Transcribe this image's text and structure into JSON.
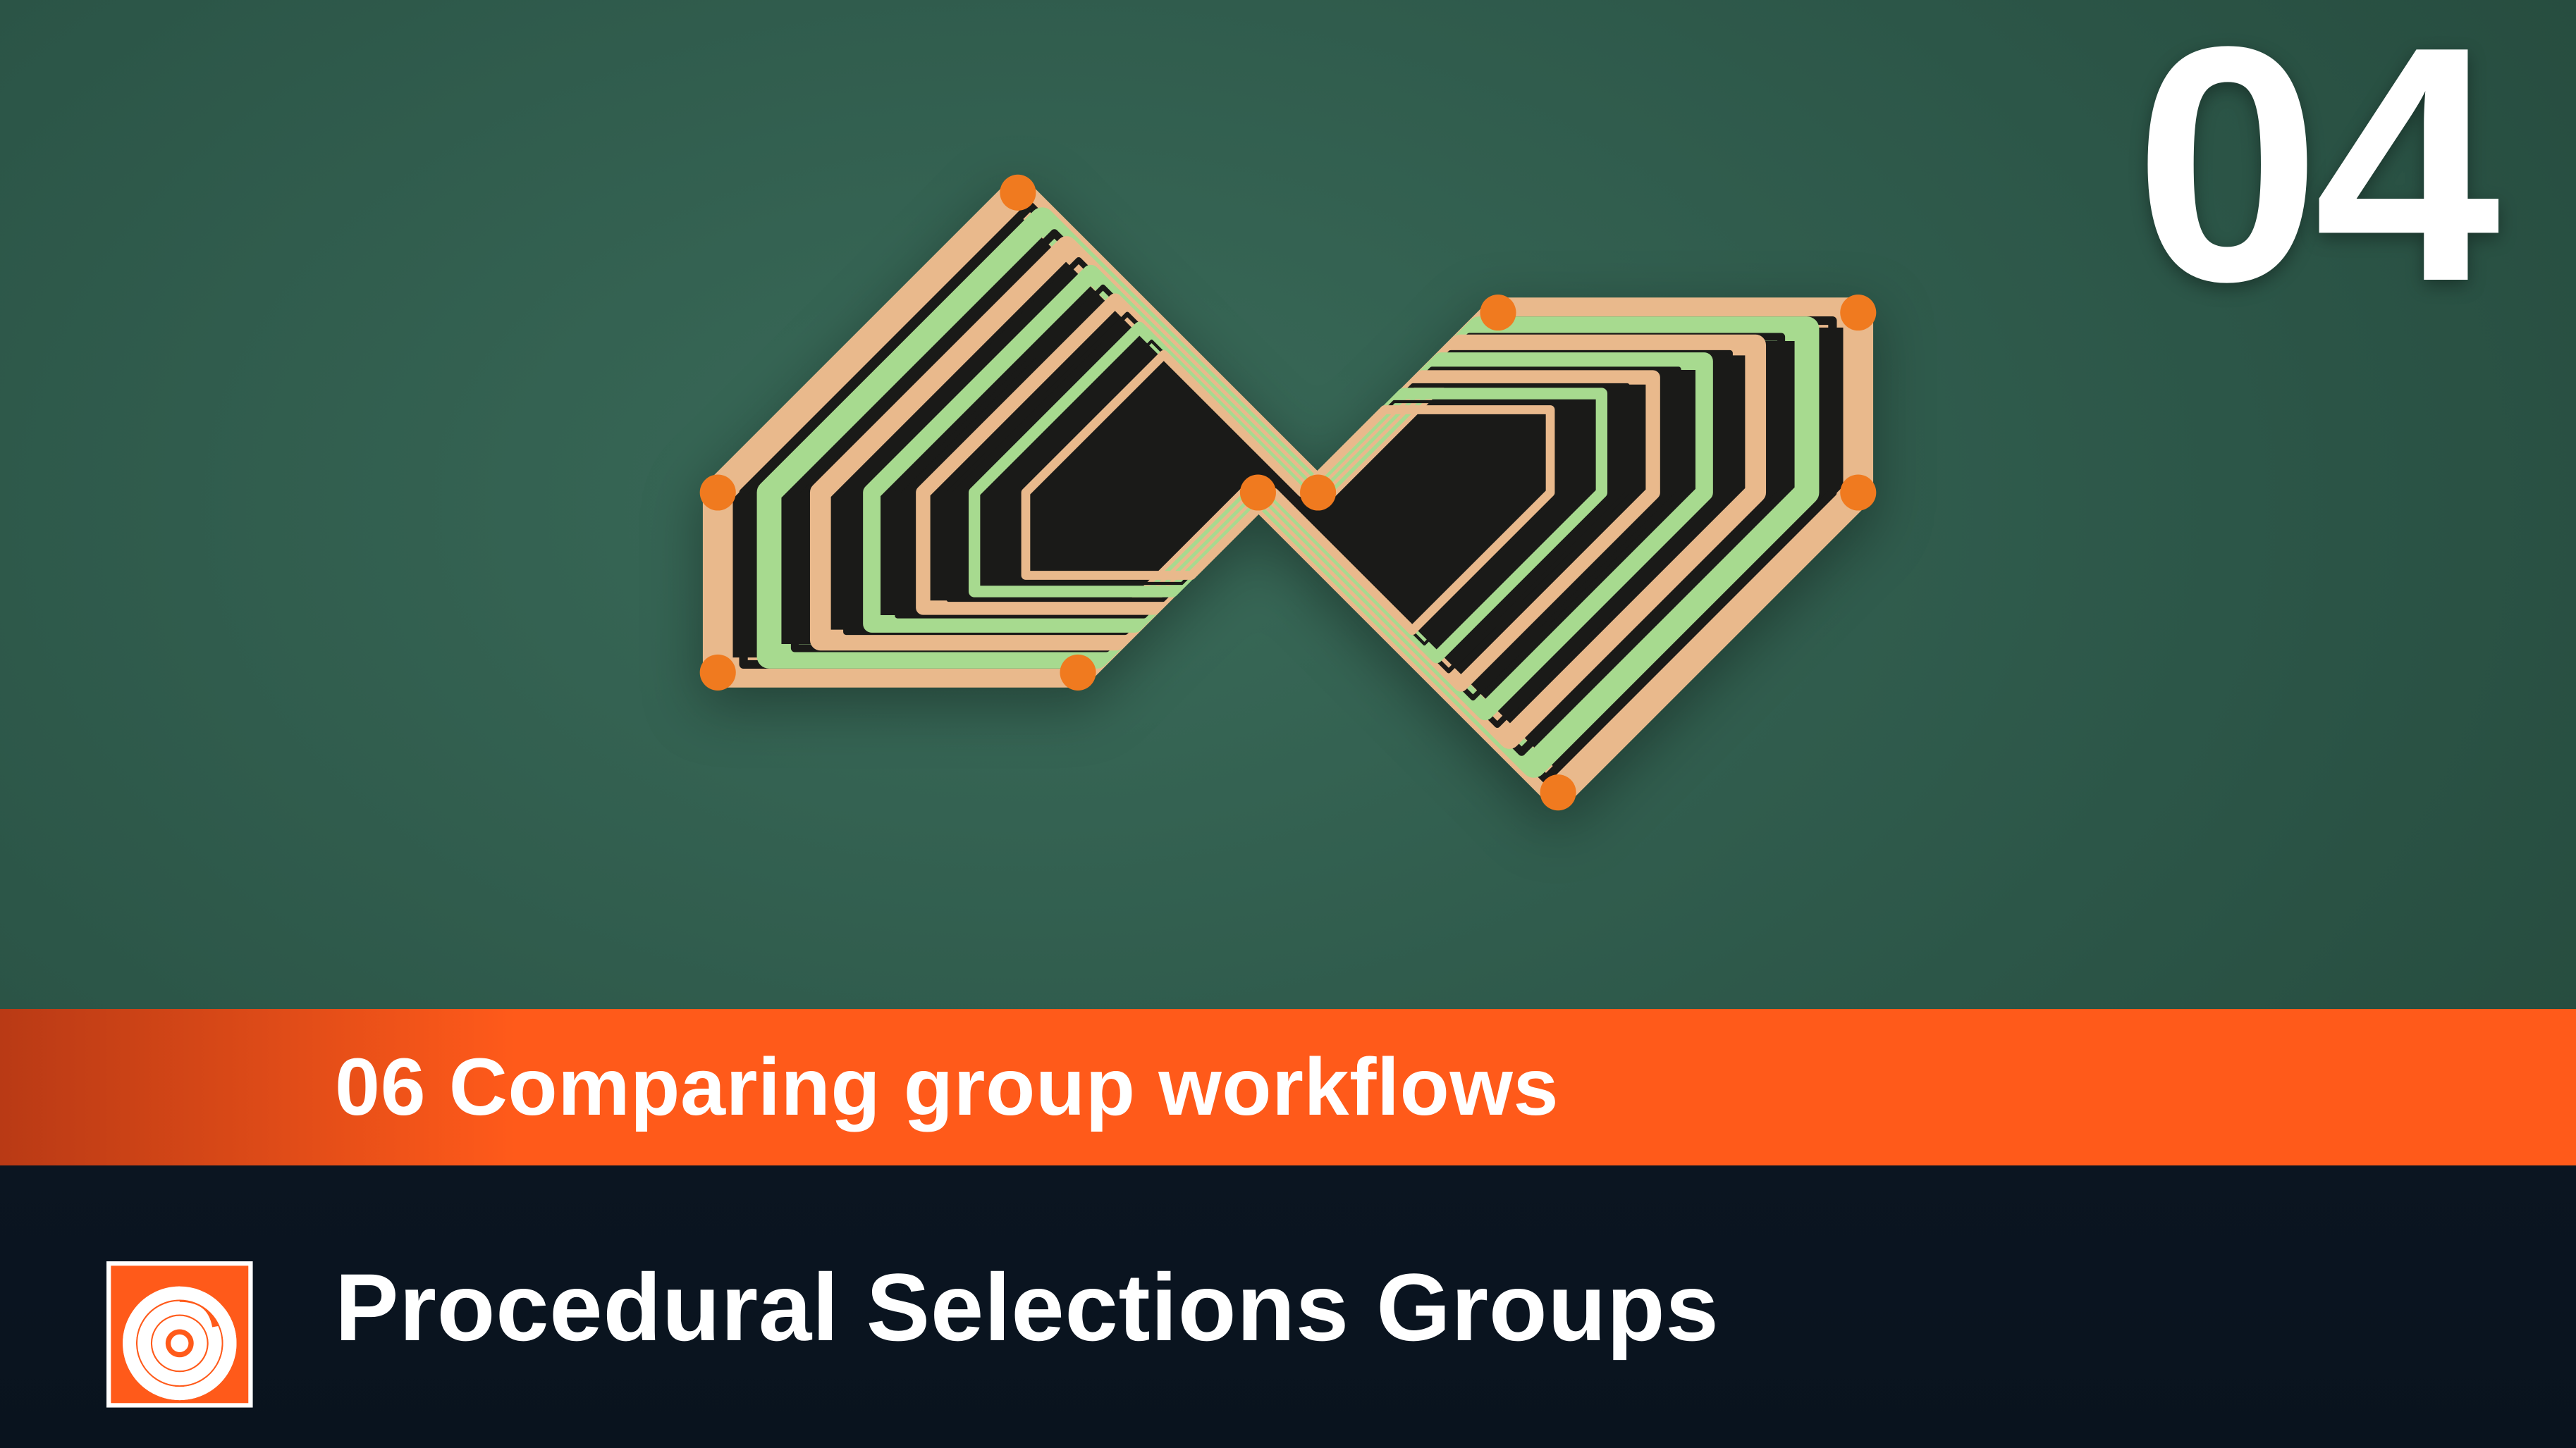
{
  "episode_number": "04",
  "subtitle": "06 Comparing group workflows",
  "course_title": "Procedural Selections Groups",
  "colors": {
    "bg_green": "#2e5a4a",
    "orange": "#ff5a1a",
    "orange_dark": "#b93a15",
    "dark_navy": "#0b1521",
    "stripe_peach": "#e9b98c",
    "stripe_green": "#a7da8f",
    "corner_orange": "#f07a1f"
  }
}
